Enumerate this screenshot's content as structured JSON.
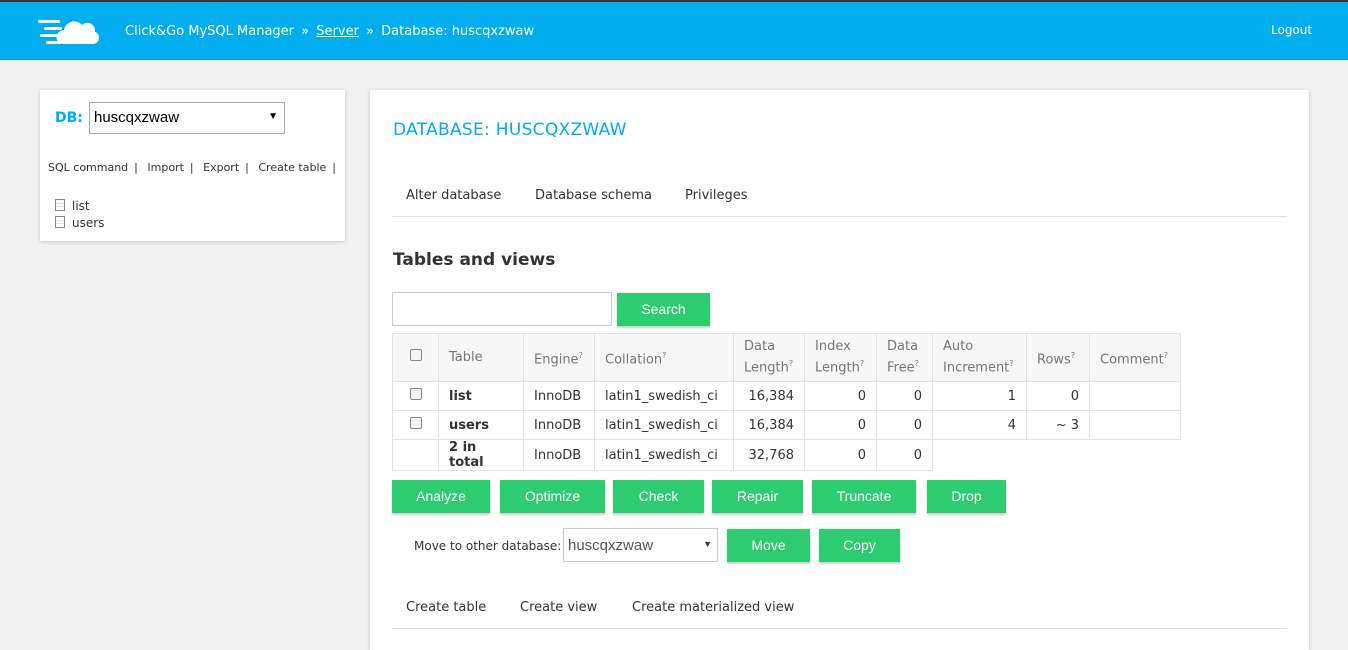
{
  "header": {
    "app_name": "Click&Go MySQL Manager",
    "separator": "»",
    "server_link": "Server",
    "database_crumb": "Database: huscqxzwaw",
    "logout": "Logout",
    "logo_icon": "cloud-speed-icon"
  },
  "sidebar": {
    "db_label": "DB:",
    "db_selected": "huscqxzwaw",
    "links": [
      "SQL command",
      "Import",
      "Export",
      "Create table"
    ],
    "link_separator": "|",
    "tables": [
      "list",
      "users"
    ]
  },
  "main": {
    "title": "DATABASE: HUSCQXZWAW",
    "tabs": [
      "Alter database",
      "Database schema",
      "Privileges"
    ],
    "section_title": "Tables and views",
    "search_placeholder": "",
    "search_button": "Search",
    "table": {
      "headers": {
        "table": "Table",
        "engine": "Engine",
        "collation": "Collation",
        "data_length_1": "Data",
        "data_length_2": "Length",
        "index_length_1": "Index",
        "index_length_2": "Length",
        "data_free_1": "Data",
        "data_free_2": "Free",
        "auto_increment_1": "Auto",
        "auto_increment_2": "Increment",
        "rows": "Rows",
        "comment": "Comment",
        "help_mark": "?"
      },
      "rows": [
        {
          "name": "list",
          "engine": "InnoDB",
          "collation": "latin1_swedish_ci",
          "data_length": "16,384",
          "index_length": "0",
          "data_free": "0",
          "auto_increment": "1",
          "rows": "0",
          "comment": ""
        },
        {
          "name": "users",
          "engine": "InnoDB",
          "collation": "latin1_swedish_ci",
          "data_length": "16,384",
          "index_length": "0",
          "data_free": "0",
          "auto_increment": "4",
          "rows": "~ 3",
          "comment": ""
        }
      ],
      "total": {
        "name": "2 in total",
        "engine": "InnoDB",
        "collation": "latin1_swedish_ci",
        "data_length": "32,768",
        "index_length": "0",
        "data_free": "0"
      }
    },
    "actions": [
      "Analyze",
      "Optimize",
      "Check",
      "Repair",
      "Truncate",
      "Drop"
    ],
    "move_label": "Move to other database:",
    "move_selected": "huscqxzwaw",
    "move_button": "Move",
    "copy_button": "Copy",
    "bottom_tabs": [
      "Create table",
      "Create view",
      "Create materialized view"
    ]
  },
  "colors": {
    "header_bg": "#00adee",
    "accent": "#00adee",
    "button_bg": "#2ecc71",
    "page_bg": "#f1f1f1"
  }
}
